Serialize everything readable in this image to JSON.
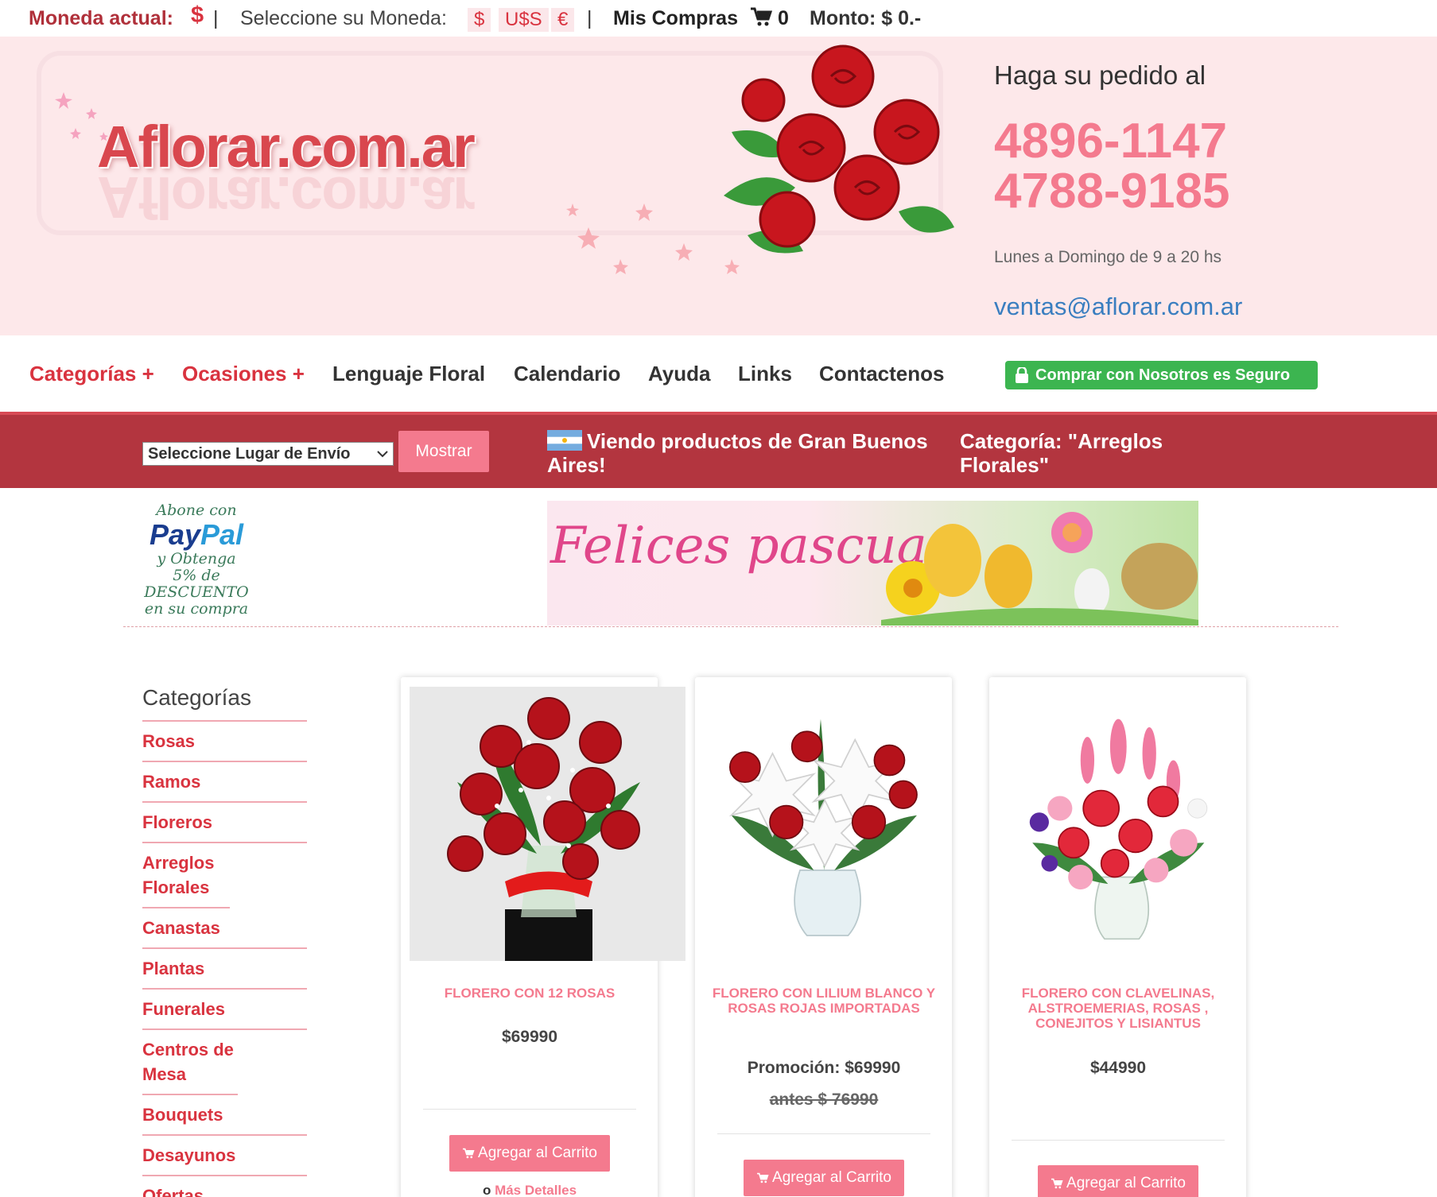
{
  "topbar": {
    "moneda_label": "Moneda actual:",
    "moneda_value": "$",
    "separator": "|",
    "select_label": "Seleccione su Moneda:",
    "currencies": [
      "$",
      "U$S",
      "€"
    ],
    "compras_label": "Mis Compras",
    "cart_count": "0",
    "monto": "Monto: $ 0.-"
  },
  "header": {
    "logo_text": "Aflorar.com.ar",
    "contact_title": "Haga su pedido al",
    "phone1": "4896-1147",
    "phone2": "4788-9185",
    "hours": "Lunes a Domingo de 9 a 20 hs",
    "email": "ventas@aflorar.com.ar"
  },
  "nav": {
    "items": [
      "Categorías +",
      "Ocasiones +",
      "Lenguaje Floral",
      "Calendario",
      "Ayuda",
      "Links",
      "Contactenos"
    ],
    "secure_label": "Comprar con Nosotros es Seguro"
  },
  "location": {
    "select_value": "Seleccione Lugar de Envío",
    "button_label": "Mostrar",
    "viewing_text": "Viendo productos de Gran Buenos Aires!",
    "category_text": "Categoría: \"Arreglos Florales\""
  },
  "promo": {
    "paypal_line1": "Abone con",
    "paypal_brand_a": "Pay",
    "paypal_brand_b": "Pal",
    "paypal_line2": "y Obtenga",
    "paypal_line3": "5% de",
    "paypal_line4": "DESCUENTO",
    "paypal_line5": "en su compra",
    "banner_text": "Felices pascuas"
  },
  "sidebar": {
    "title": "Categorías",
    "items": [
      "Rosas",
      "Ramos",
      "Floreros",
      "Arreglos Florales",
      "Canastas",
      "Plantas",
      "Funerales",
      "Centros de Mesa",
      "Bouquets",
      "Desayunos",
      "Ofertas"
    ]
  },
  "products": [
    {
      "name": "FLORERO CON 12 ROSAS",
      "price": "$69990",
      "cart_label": "Agregar al Carrito",
      "more_prefix": "o",
      "more_label": "Más Detalles"
    },
    {
      "name": "FLORERO CON LILIUM BLANCO Y ROSAS ROJAS IMPORTADAS",
      "price": "Promoción: $69990",
      "antes": "antes $ 76990",
      "cart_label": "Agregar al Carrito"
    },
    {
      "name": "FLORERO CON CLAVELINAS, ALSTROEMERIAS, ROSAS , CONEJITOS Y LISIANTUS",
      "price": "$44990",
      "cart_label": "Agregar al Carrito"
    }
  ],
  "colors": {
    "brand_red": "#d9333f",
    "pink": "#f47a8e",
    "bar_red": "#b3353f",
    "secure_green": "#3cb550",
    "header_bg": "#fde8ea",
    "link_blue": "#3a7ec0"
  }
}
